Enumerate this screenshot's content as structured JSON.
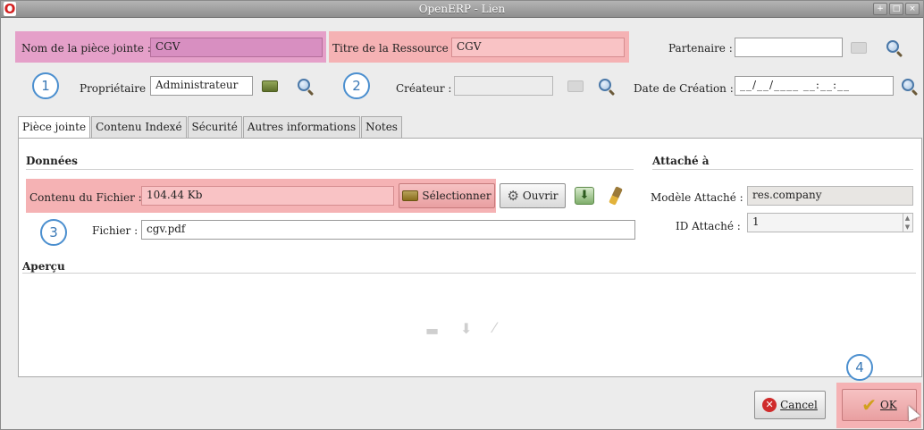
{
  "window": {
    "title": "OpenERP - Lien",
    "controls": [
      "+",
      "□",
      "×"
    ]
  },
  "header": {
    "nom_label": "Nom de la pièce jointe :",
    "nom_value": "CGV",
    "titre_label": "Titre de la Ressource :",
    "titre_value": "CGV",
    "partenaire_label": "Partenaire :",
    "partenaire_value": "",
    "proprietaire_label": "Propriétaire :",
    "proprietaire_value": "Administrateur",
    "createur_label": "Créateur :",
    "createur_value": "",
    "date_label": "Date de Création :",
    "date_value": "__/__/____ __:__:__"
  },
  "annotations": [
    "1",
    "2",
    "3",
    "4"
  ],
  "tabs": [
    "Pièce jointe",
    "Contenu Indexé",
    "Sécurité",
    "Autres informations",
    "Notes"
  ],
  "donnees": {
    "section_title": "Données",
    "contenu_label": "Contenu du Fichier :",
    "contenu_value": "104.44 Kb",
    "select_label": "Sélectionner",
    "open_label": "Ouvrir",
    "fichier_label": "Fichier :",
    "fichier_value": "cgv.pdf"
  },
  "attache": {
    "section_title": "Attaché à",
    "modele_label": "Modèle Attaché :",
    "modele_value": "res.company",
    "id_label": "ID Attaché :",
    "id_value": "1"
  },
  "apercu": {
    "section_title": "Aperçu"
  },
  "footer": {
    "cancel_label": "Cancel",
    "ok_label": "OK"
  },
  "colors": {
    "highlight_red": "#f5b2b4",
    "highlight_pink": "#e5a0c9",
    "annotation_blue": "#4b8fcf"
  }
}
